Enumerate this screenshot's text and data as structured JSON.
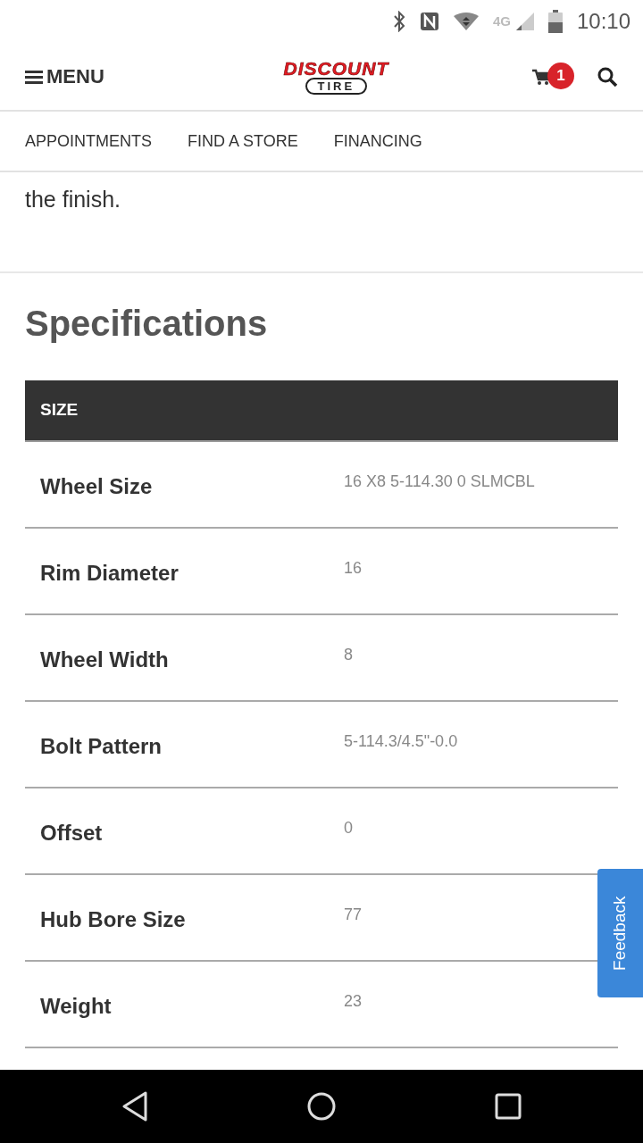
{
  "status_bar": {
    "network": "4G",
    "time": "10:10"
  },
  "header": {
    "menu_label": "MENU",
    "logo": {
      "top": "DISCOUNT",
      "bottom": "TIRE"
    },
    "cart_count": "1"
  },
  "nav": [
    "APPOINTMENTS",
    "FIND A STORE",
    "FINANCING"
  ],
  "intro_text": "the finish.",
  "specifications": {
    "title": "Specifications",
    "section": "SIZE",
    "rows": [
      {
        "label": "Wheel Size",
        "value": "16 X8 5-114.30 0 SLMCBL"
      },
      {
        "label": "Rim Diameter",
        "value": "16"
      },
      {
        "label": "Wheel Width",
        "value": "8"
      },
      {
        "label": "Bolt Pattern",
        "value": "5-114.3/4.5\"-0.0"
      },
      {
        "label": "Offset",
        "value": "0"
      },
      {
        "label": "Hub Bore Size",
        "value": "77"
      },
      {
        "label": "Weight",
        "value": "23"
      }
    ]
  },
  "feedback_tab": "Feedback"
}
